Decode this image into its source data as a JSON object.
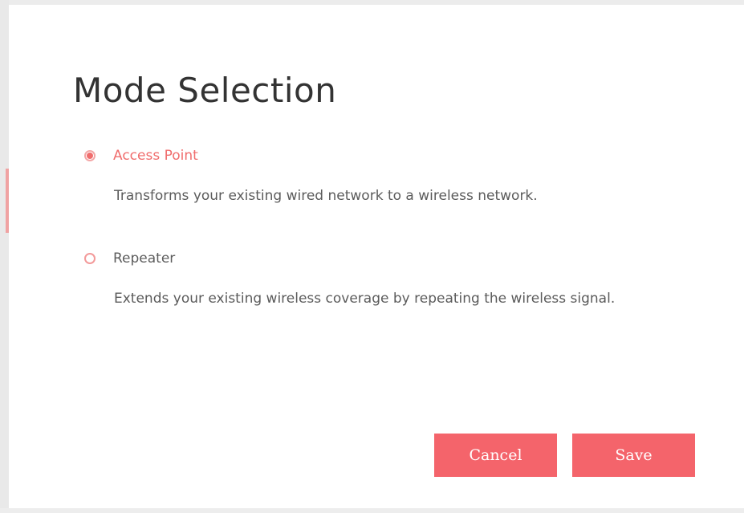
{
  "dialog": {
    "title": "Mode Selection",
    "options": [
      {
        "label": "Access Point",
        "description": "Transforms your existing wired network to a wireless network.",
        "selected": true
      },
      {
        "label": "Repeater",
        "description": "Extends your existing wireless coverage by repeating the wireless signal.",
        "selected": false
      }
    ],
    "buttons": {
      "cancel_label": "Cancel",
      "save_label": "Save"
    }
  },
  "colors": {
    "accent": "#f4646b",
    "text": "#5b5b5b",
    "title": "#333333"
  }
}
